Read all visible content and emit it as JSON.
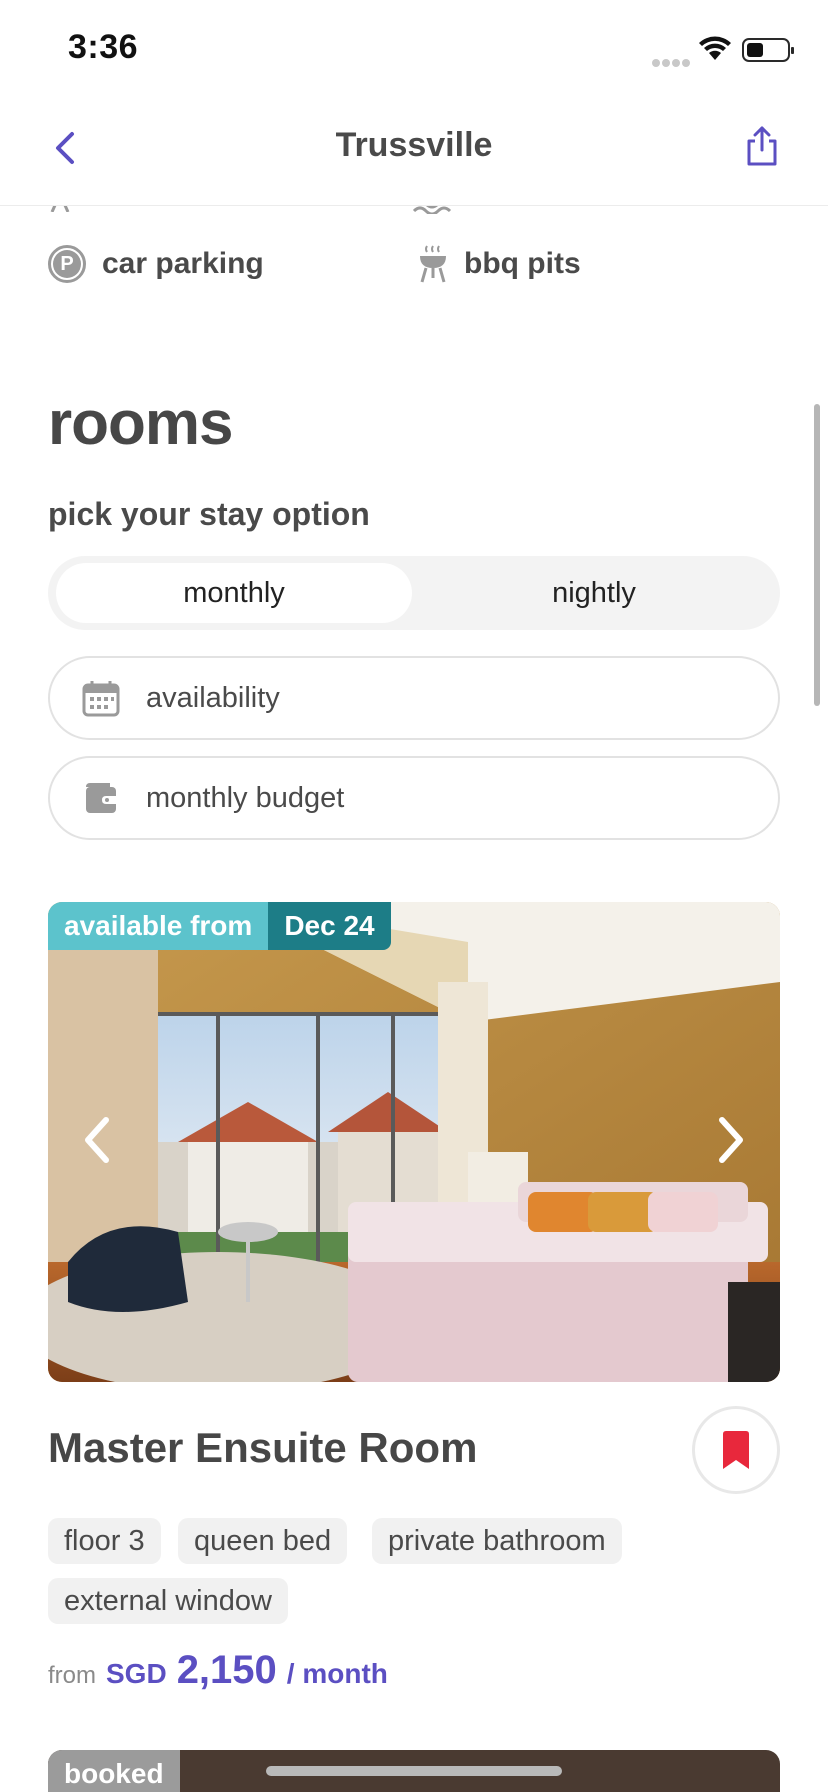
{
  "status_bar": {
    "time": "3:36"
  },
  "nav": {
    "title": "Trussville"
  },
  "amenities": [
    {
      "icon": "parking-icon",
      "label": "car parking"
    },
    {
      "icon": "bbq-icon",
      "label": "bbq pits"
    }
  ],
  "rooms": {
    "title": "rooms",
    "stay_prompt": "pick your stay option",
    "stay_options": [
      "monthly",
      "nightly"
    ],
    "selected_option": "monthly",
    "availability_label": "availability",
    "budget_label": "monthly budget"
  },
  "room_card": {
    "badge_label": "available from",
    "badge_date": "Dec 24",
    "title": "Master Ensuite Room",
    "tags": [
      "floor 3",
      "queen bed",
      "private bathroom",
      "external window"
    ],
    "price_prefix": "from",
    "currency": "SGD",
    "price": "2,150",
    "period": "/ month"
  },
  "next_card": {
    "badge": "booked"
  },
  "colors": {
    "accent": "#5b4fc2",
    "badge_light": "#5cc3cc",
    "badge_dark": "#1d7d87",
    "bookmark": "#e8283c"
  }
}
